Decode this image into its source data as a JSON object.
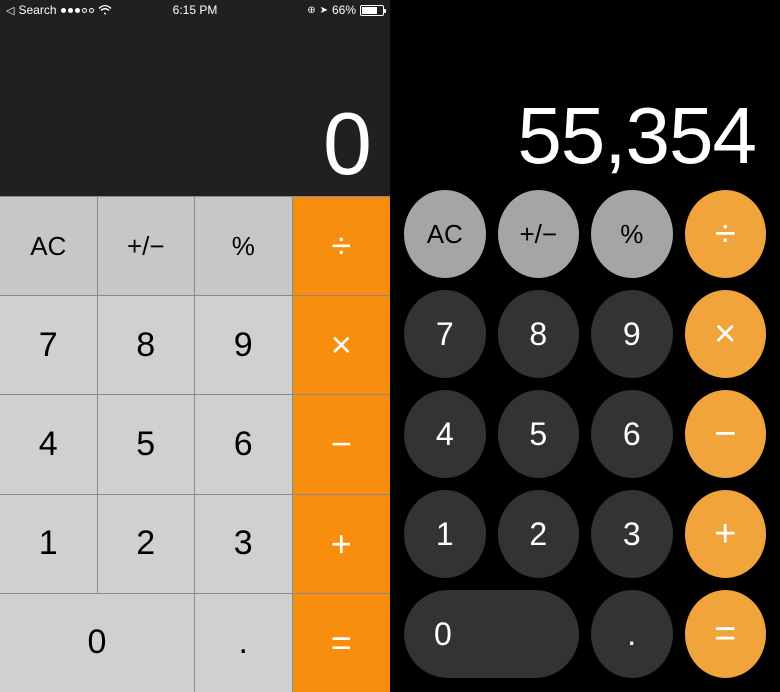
{
  "left": {
    "status": {
      "back_label": "Search",
      "time": "6:15 PM",
      "battery_pct": "66%"
    },
    "display": "0",
    "keys": {
      "ac": "AC",
      "sign": "+/−",
      "percent": "%",
      "divide": "÷",
      "n7": "7",
      "n8": "8",
      "n9": "9",
      "multiply": "×",
      "n4": "4",
      "n5": "5",
      "n6": "6",
      "minus": "−",
      "n1": "1",
      "n2": "2",
      "n3": "3",
      "plus": "+",
      "n0": "0",
      "decimal": ".",
      "equals": "="
    }
  },
  "right": {
    "display": "55,354",
    "keys": {
      "ac": "AC",
      "sign": "+/−",
      "percent": "%",
      "divide": "÷",
      "n7": "7",
      "n8": "8",
      "n9": "9",
      "multiply": "×",
      "n4": "4",
      "n5": "5",
      "n6": "6",
      "minus": "−",
      "n1": "1",
      "n2": "2",
      "n3": "3",
      "plus": "+",
      "n0": "0",
      "decimal": ".",
      "equals": "="
    }
  }
}
